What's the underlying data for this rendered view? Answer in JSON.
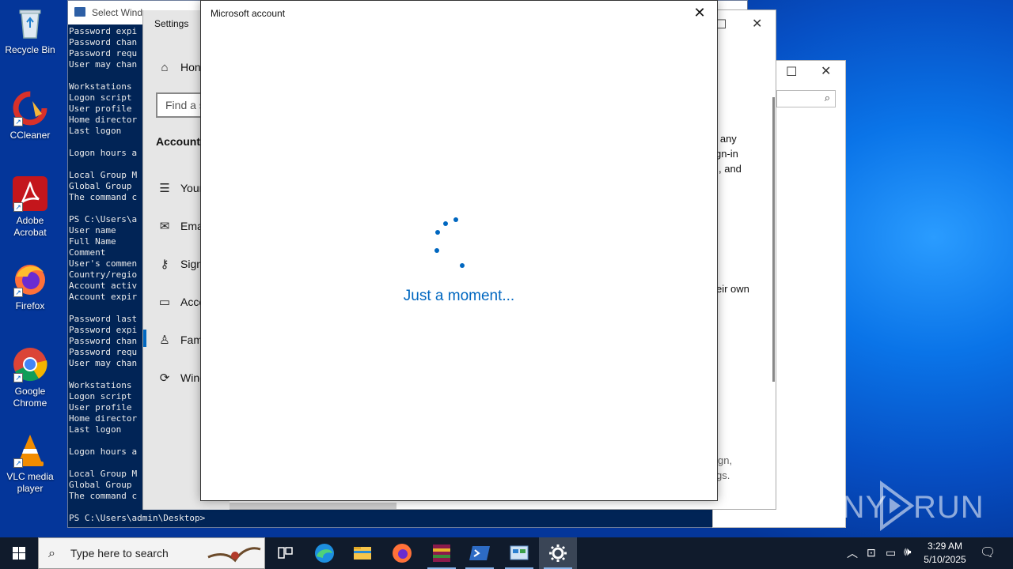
{
  "desktop": {
    "icons": [
      {
        "label": "Recycle Bin",
        "icon": "recycle-bin-icon"
      },
      {
        "label": "CCleaner",
        "icon": "ccleaner-icon"
      },
      {
        "label": "Adobe Acrobat",
        "icon": "adobe-acrobat-icon"
      },
      {
        "label": "Firefox",
        "icon": "firefox-icon"
      },
      {
        "label": "Google Chrome",
        "icon": "chrome-icon"
      },
      {
        "label": "VLC media player",
        "icon": "vlc-icon"
      }
    ]
  },
  "console": {
    "title": "Select Wind",
    "lines": [
      "Password expi",
      "Password chan",
      "Password requ",
      "User may chan",
      "",
      "Workstations",
      "Logon script",
      "User profile",
      "Home director",
      "Last logon",
      "",
      "Logon hours a",
      "",
      "Local Group M",
      "Global Group",
      "The command c",
      "",
      "PS C:\\Users\\a",
      "User name",
      "Full Name",
      "Comment",
      "User's commen",
      "Country/regio",
      "Account activ",
      "Account expir",
      "",
      "Password last",
      "Password expi",
      "Password chan",
      "Password requ",
      "User may chan",
      "",
      "Workstations",
      "Logon script",
      "User profile",
      "Home director",
      "Last logon",
      "",
      "Logon hours a",
      "",
      "Local Group M",
      "Global Group",
      "The command c",
      "",
      "PS C:\\Users\\admin\\Desktop>"
    ]
  },
  "back_window": {
    "partial_text": [
      "d any",
      "gn-in",
      ", and",
      "eir own",
      "gn,",
      "gs."
    ]
  },
  "settings": {
    "title": "Settings",
    "home": "Hon",
    "search_placeholder": "Find a s",
    "section": "Accounts",
    "items": [
      {
        "label": "Your",
        "icon": "user-info-icon"
      },
      {
        "label": "Ema",
        "icon": "mail-icon"
      },
      {
        "label": "Sign",
        "icon": "key-icon"
      },
      {
        "label": "Acce",
        "icon": "briefcase-icon"
      },
      {
        "label": "Fami",
        "icon": "family-icon"
      },
      {
        "label": "Wind",
        "icon": "sync-icon"
      }
    ]
  },
  "dialog": {
    "title": "Microsoft account",
    "loading_text": "Just a moment..."
  },
  "taskbar": {
    "search_placeholder": "Type here to search",
    "apps": [
      "task-view",
      "edge",
      "file-explorer",
      "firefox",
      "winrar",
      "powershell",
      "control-panel",
      "settings"
    ],
    "time": "3:29 AM",
    "date": "5/10/2025"
  },
  "watermark": {
    "left": "ANY",
    "right": "RUN"
  },
  "colors": {
    "accent": "#0067c0",
    "console_bg": "#012456",
    "taskbar_bg": "#101b2c"
  }
}
